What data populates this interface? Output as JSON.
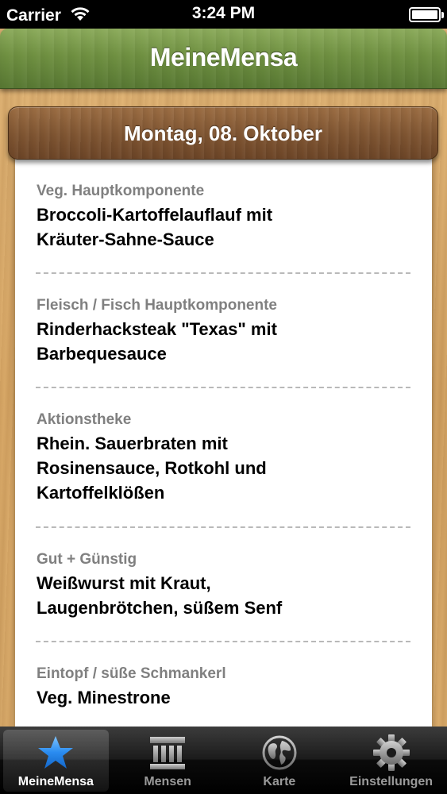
{
  "status_bar": {
    "carrier": "Carrier",
    "time": "3:24 PM"
  },
  "nav": {
    "title": "MeineMensa"
  },
  "date_header": {
    "label": "Montag, 08. Oktober"
  },
  "menu": [
    {
      "category": "Veg. Hauptkomponente",
      "dish": "Broccoli-Kartoffelauflauf mit Kräuter-Sahne-Sauce"
    },
    {
      "category": "Fleisch / Fisch Hauptkomponente",
      "dish": "Rinderhacksteak \"Texas\" mit Barbequesauce"
    },
    {
      "category": "Aktionstheke",
      "dish": "Rhein. Sauerbraten mit Rosinensauce, Rotkohl und Kartoffelklößen"
    },
    {
      "category": "Gut + Günstig",
      "dish": "Weißwurst mit Kraut, Laugenbrötchen, süßem Senf"
    },
    {
      "category": "Eintopf / süße Schmankerl",
      "dish": "Veg. Minestrone"
    }
  ],
  "tabs": [
    {
      "label": "MeineMensa",
      "icon": "star-icon",
      "selected": true
    },
    {
      "label": "Mensen",
      "icon": "building-icon",
      "selected": false
    },
    {
      "label": "Karte",
      "icon": "globe-icon",
      "selected": false
    },
    {
      "label": "Einstellungen",
      "icon": "gear-icon",
      "selected": false
    }
  ],
  "colors": {
    "nav_green": "#6f9041",
    "header_brown": "#7e5431",
    "category_gray": "#808080",
    "tab_selected_blue": "#2a8cf0"
  }
}
